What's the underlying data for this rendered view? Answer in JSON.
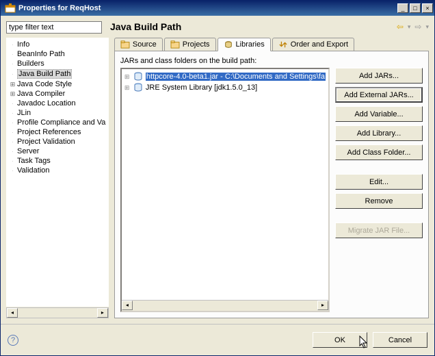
{
  "window": {
    "title": "Properties for ReqHost"
  },
  "filter": {
    "value": "",
    "placeholder": "type filter text"
  },
  "heading": "Java Build Path",
  "tree": {
    "items": [
      {
        "label": "Info",
        "expandable": false
      },
      {
        "label": "BeanInfo Path",
        "expandable": false
      },
      {
        "label": "Builders",
        "expandable": false
      },
      {
        "label": "Java Build Path",
        "expandable": false,
        "selected": true
      },
      {
        "label": "Java Code Style",
        "expandable": true
      },
      {
        "label": "Java Compiler",
        "expandable": true
      },
      {
        "label": "Javadoc Location",
        "expandable": false
      },
      {
        "label": "JLin",
        "expandable": false
      },
      {
        "label": "Profile Compliance and Va",
        "expandable": false
      },
      {
        "label": "Project References",
        "expandable": false
      },
      {
        "label": "Project Validation",
        "expandable": false
      },
      {
        "label": "Server",
        "expandable": false
      },
      {
        "label": "Task Tags",
        "expandable": false
      },
      {
        "label": "Validation",
        "expandable": false
      }
    ]
  },
  "tabs": {
    "source": "Source",
    "projects": "Projects",
    "libraries": "Libraries",
    "order": "Order and Export"
  },
  "libraries": {
    "label": "JARs and class folders on the build path:",
    "items": [
      {
        "label": "httpcore-4.0-beta1.jar - C:\\Documents and Settings\\fa",
        "selected": true
      },
      {
        "label": "JRE System Library [jdk1.5.0_13]",
        "selected": false
      }
    ]
  },
  "buttons": {
    "add_jars": "Add JARs...",
    "add_external_jars": "Add External JARs...",
    "add_variable": "Add Variable...",
    "add_library": "Add Library...",
    "add_class_folder": "Add Class Folder...",
    "edit": "Edit...",
    "remove": "Remove",
    "migrate": "Migrate JAR File..."
  },
  "bottom": {
    "ok": "OK",
    "cancel": "Cancel"
  }
}
